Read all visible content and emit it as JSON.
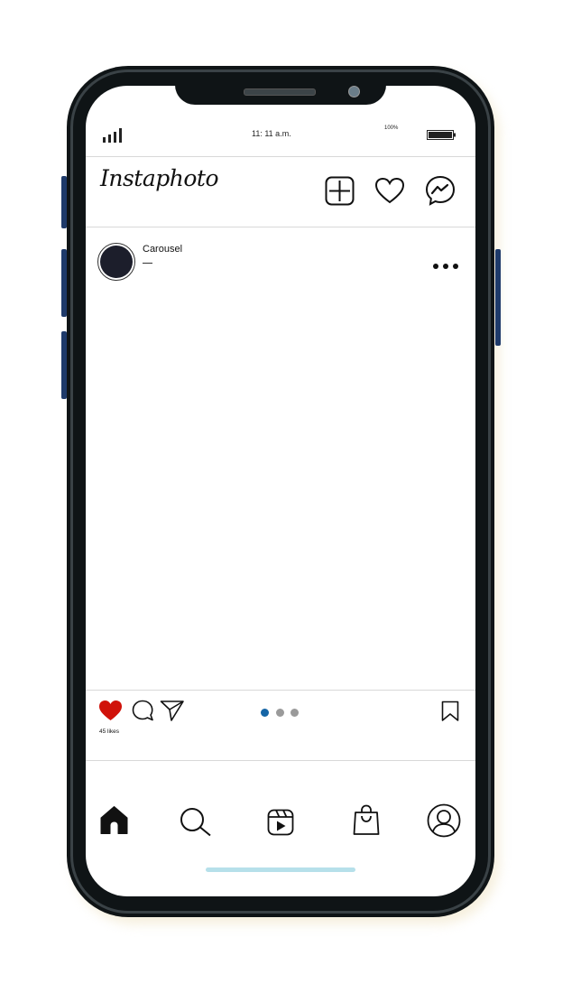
{
  "status_bar": {
    "time": "11: 11 a.m.",
    "battery_percent": "100%"
  },
  "header": {
    "logo": "Instaphoto",
    "icons": [
      "plus-square-icon",
      "heart-icon",
      "messenger-icon"
    ]
  },
  "post": {
    "username": "Carousel",
    "likes": "45 likes",
    "liked": true,
    "carousel_dots": 3,
    "active_dot": 0
  },
  "bottom_nav": {
    "items": [
      "home-icon",
      "search-icon",
      "reels-icon",
      "shop-icon",
      "profile-icon"
    ]
  },
  "colors": {
    "heart": "#d0120a",
    "active_dot": "#1565a6",
    "inactive_dot": "#9a9a9a",
    "home_indicator": "#b6e0ea",
    "side_buttons": "#1e3a6a"
  }
}
